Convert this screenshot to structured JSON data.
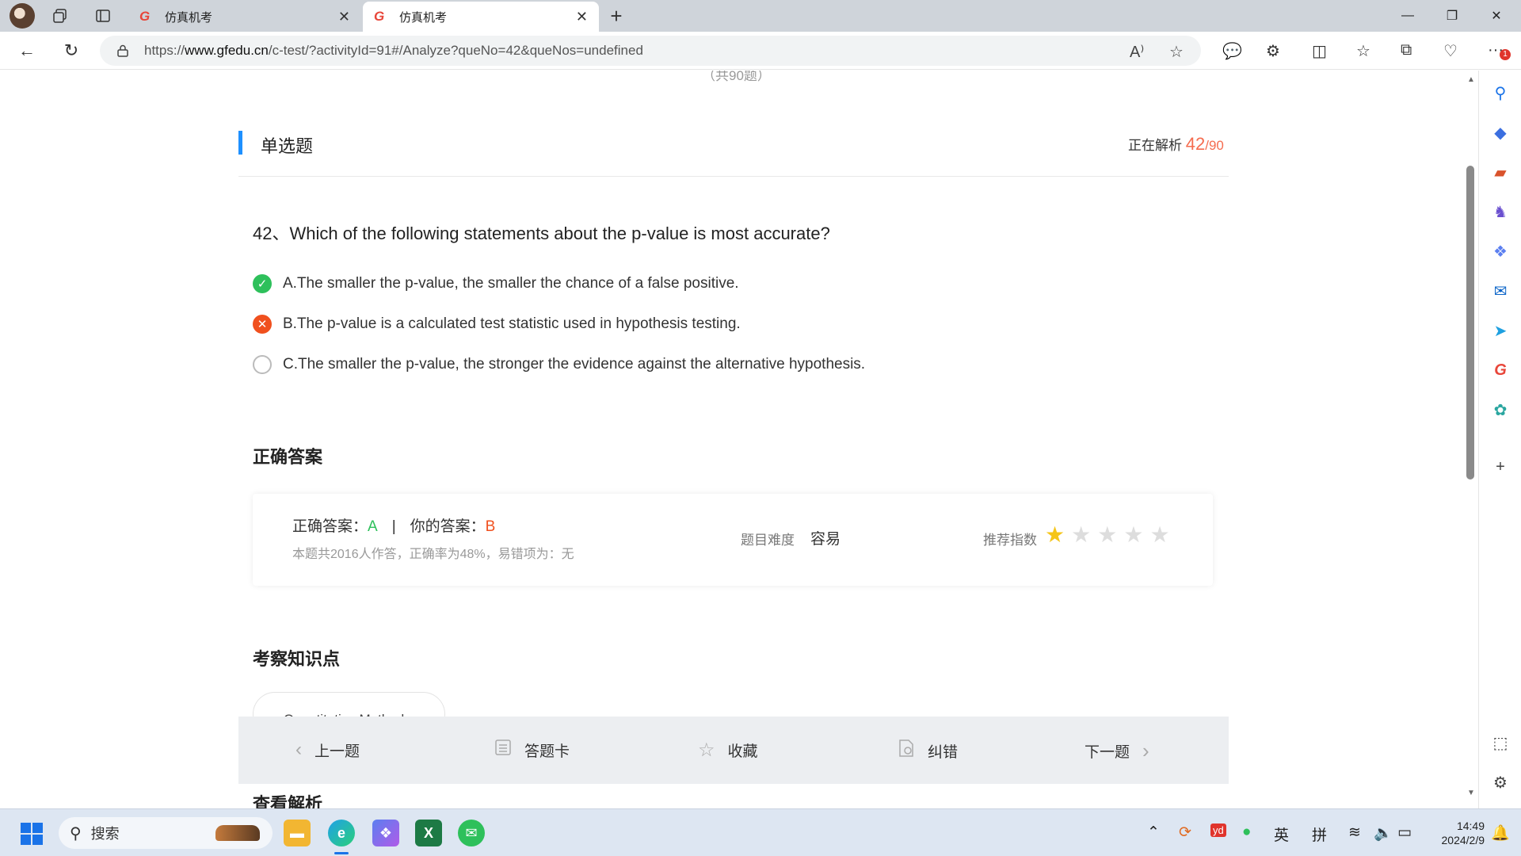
{
  "browser": {
    "tabs": [
      {
        "label": "仿真机考",
        "active": false
      },
      {
        "label": "仿真机考",
        "active": true
      }
    ],
    "url_prefix": "https://",
    "url_host": "www.gfedu.cn",
    "url_path": "/c-test/?activityId=91#/Analyze?queNo=42&queNos=undefined"
  },
  "page": {
    "total_top": "（共90题）",
    "question_type": "单选题",
    "progress_label": "正在解析 ",
    "progress_current": "42",
    "progress_total": "/90",
    "question": "42、Which of the following statements about the p-value is most accurate?",
    "options": [
      {
        "text": "A.The smaller the p-value, the smaller the chance of a false positive.",
        "status": "correct"
      },
      {
        "text": "B.The p-value is a calculated test statistic used in hypothesis testing.",
        "status": "wrong"
      },
      {
        "text": "C.The smaller the p-value, the stronger the evidence against the alternative hypothesis.",
        "status": "none"
      }
    ],
    "correct_section_title": "正确答案",
    "answer": {
      "correct_label": "正确答案：",
      "correct_value": "A",
      "separator": "|",
      "your_label": "你的答案：",
      "your_value": "B",
      "stats": "本题共2016人作答，正确率为48%，易错项为：无",
      "difficulty_label": "题目难度",
      "difficulty_value": "容易",
      "recommend_label": "推荐指数",
      "recommend_stars": 1,
      "recommend_max": 5
    },
    "knowledge_title": "考察知识点",
    "knowledge_tag": "Quantitative Methods",
    "analysis_title": "查看解析",
    "bottom_bar": {
      "prev": "上一题",
      "card": "答题卡",
      "favorite": "收藏",
      "report": "纠错",
      "next": "下一题"
    }
  },
  "taskbar": {
    "search_placeholder": "搜索",
    "ime_lang": "英",
    "ime_mode": "拼",
    "time": "14:49",
    "date": "2024/2/9",
    "edge_badge": "1"
  },
  "colors": {
    "accent": "#1e90ff",
    "correct": "#2ec05b",
    "wrong": "#f0501e",
    "progress": "#f56c4f",
    "star": "#f5c518"
  }
}
